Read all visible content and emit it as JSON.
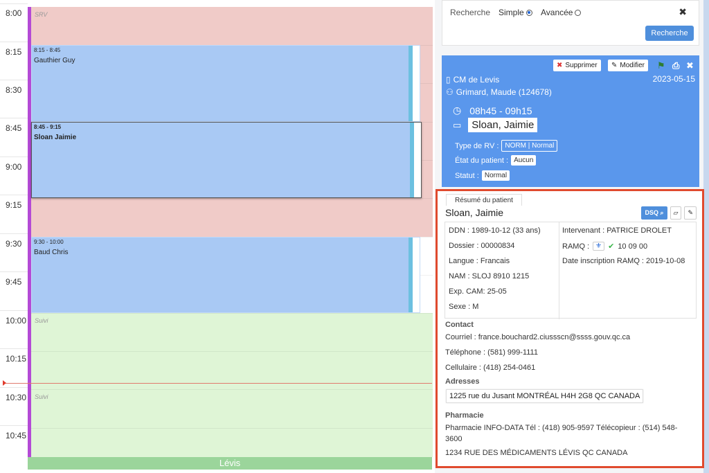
{
  "calendar": {
    "times": [
      "8:00",
      "8:15",
      "8:30",
      "8:45",
      "9:00",
      "9:15",
      "9:30",
      "9:45",
      "10:00",
      "10:15",
      "10:30",
      "10:45"
    ],
    "blocks": [
      {
        "label": "SRV",
        "color": "#f0cbc8"
      },
      {
        "label": "Suivi",
        "color": "#dff5d6"
      },
      {
        "label": "Suivi",
        "color": "#dff5d6"
      }
    ],
    "appointments": [
      {
        "time": "8:15 - 8:45",
        "name": "Gauthier Guy"
      },
      {
        "time": "8:45 - 9:15",
        "name": "Sloan Jaimie"
      },
      {
        "time": "9:30 - 10:00",
        "name": "Baud Chris"
      }
    ],
    "footer": "Lévis"
  },
  "search": {
    "label": "Recherche",
    "option_simple": "Simple",
    "option_advanced": "Avancée",
    "selected": "Simple",
    "button": "Recherche"
  },
  "appointment_panel": {
    "delete_label": "Supprimer",
    "edit_label": "Modifier",
    "date": "2023-05-15",
    "clinic": "CM de Levis",
    "provider": "Grimard, Maude (124678)",
    "time_range": "08h45 - 09h15",
    "patient_name": "Sloan, Jaimie",
    "type_label": "Type de RV :",
    "type_value": "NORM | Normal",
    "state_label": "État du patient :",
    "state_value": "Aucun",
    "status_label": "Statut :",
    "status_value": "Normal",
    "color": "#5a97ec"
  },
  "patient_summary": {
    "tab": "Résumé du patient",
    "name": "Sloan, Jaimie",
    "dsq_label": "DSQ",
    "left_fields": [
      {
        "label": "DDN",
        "value": "1989-10-12 (33 ans)"
      },
      {
        "label": "Dossier",
        "value": "00000834"
      },
      {
        "label": "Langue",
        "value": "Francais"
      },
      {
        "label": "NAM",
        "value": "SLOJ 8910 1215"
      },
      {
        "label": "Exp. CAM",
        "value": "25-05"
      },
      {
        "label": "Sexe",
        "value": "M"
      }
    ],
    "intervenant_label": "Intervenant",
    "intervenant": "PATRICE DROLET",
    "ramq_label": "RAMQ :",
    "ramq_value": "10 09 00",
    "ramq_date_label": "Date inscription RAMQ",
    "ramq_date": "2019-10-08",
    "contact_title": "Contact",
    "email_label": "Courriel",
    "email": "france.bouchard2.ciussscn@ssss.gouv.qc.ca",
    "phone_label": "Téléphone",
    "phone": "(581) 999-1111",
    "cell_label": "Cellulaire",
    "cell": "(418) 254-0461",
    "address_title": "Adresses",
    "address": "1225 rue du Jusant MONTRÉAL H4H 2G8 QC CANADA",
    "pharmacy_title": "Pharmacie",
    "pharmacy_line": "Pharmacie INFO-DATA Tél : (418) 905-9597 Télécopieur : (514) 548-3600",
    "pharmacy_address": "1234 RUE DES MÉDICAMENTS LÉVIS QC CANADA",
    "highlight_color": "#e04a2e"
  }
}
